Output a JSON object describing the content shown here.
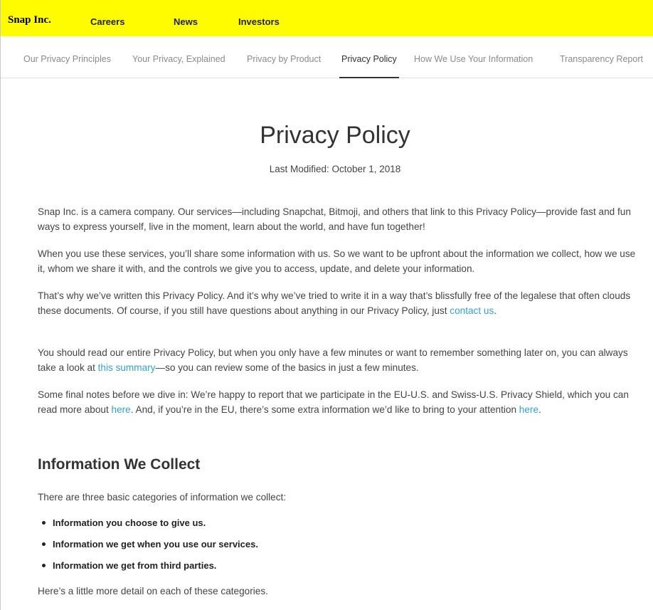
{
  "topbar": {
    "brand": "Snap Inc.",
    "nav": [
      "Careers",
      "News",
      "Investors"
    ]
  },
  "subnav": {
    "items": [
      "Our Privacy Principles",
      "Your Privacy, Explained",
      "Privacy by Product",
      "Privacy Policy",
      "How We Use Your Information",
      "Transparency Report"
    ],
    "active": "Privacy Policy"
  },
  "main": {
    "title": "Privacy Policy",
    "last_modified": "Last Modified: October 1, 2018",
    "p1": "Snap Inc. is a camera company. Our services—including Snapchat, Bitmoji, and others that link to this Privacy Policy—provide fast and fun ways to express yourself, live in the moment, learn about the world, and have fun together!",
    "p2": "When you use these services, you’ll share some information with us. So we want to be upfront about the information we collect, how we use it, whom we share it with, and the controls we give you to access, update, and delete your information.",
    "p3_text": "That’s why we’ve written this Privacy Policy. And it’s why we’ve tried to write it in a way that’s blissfully free of the legalese that often clouds these documents. Of course, if you still have questions about anything in our Privacy Policy, just ",
    "p3_link": "contact us",
    "p3_end": ".",
    "p4_text": "You should read our entire Privacy Policy, but when you only have a few minutes or want to remember something later on, you can always take a look at ",
    "p4_link": "this summary",
    "p4_end": "—so you can review some of the basics in just a few minutes.",
    "p5_text1": "Some final notes before we dive in: We’re happy to report that we participate in the EU-U.S. and Swiss-U.S. Privacy Shield, which you can read more about ",
    "p5_link1": "here",
    "p5_text2": ". And, if you’re in the EU, there’s some extra information we’d like to bring to your attention ",
    "p5_link2": "here",
    "p5_end": ".",
    "section_heading": "Information We Collect",
    "section_intro": "There are three basic categories of information we collect:",
    "bullets": [
      "Information you choose to give us.",
      "Information we get when you use our services.",
      "Information we get from third parties."
    ],
    "section_outro": "Here’s a little more detail on each of these categories."
  },
  "colors": {
    "topbar": "#fffc00",
    "link": "#2fa3d6"
  }
}
